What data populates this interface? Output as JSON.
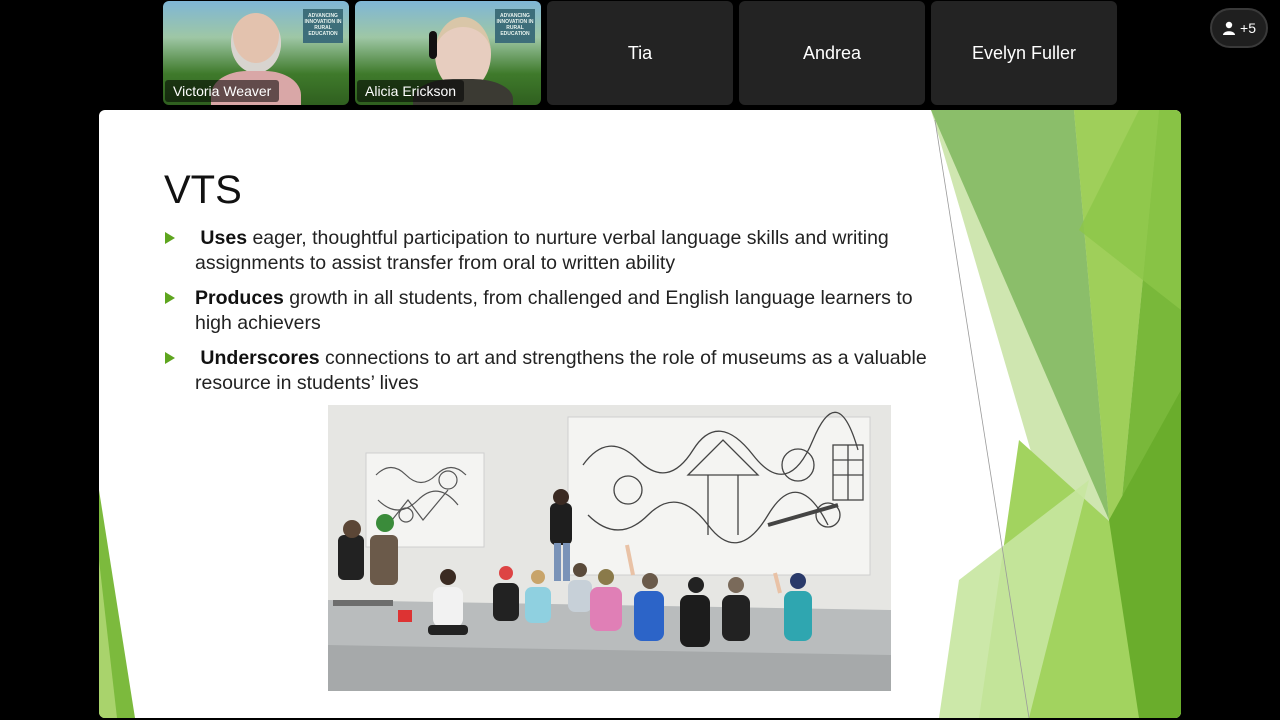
{
  "participants": [
    {
      "name": "Victoria Weaver",
      "video": true,
      "logo_text": "ADVANCING INNOVATION IN RURAL EDUCATION"
    },
    {
      "name": "Alicia Erickson",
      "video": true,
      "logo_text": "ADVANCING INNOVATION IN RURAL EDUCATION"
    },
    {
      "name": "Tia",
      "video": false
    },
    {
      "name": "Andrea",
      "video": false
    },
    {
      "name": "Evelyn Fuller",
      "video": false
    }
  ],
  "overflow": {
    "label": "+5",
    "icon": "person-icon"
  },
  "slide": {
    "title": "VTS",
    "bullets": [
      {
        "bold": "Uses",
        "text": " eager, thoughtful participation to nurture verbal language skills and writing assignments to assist transfer from oral to written ability"
      },
      {
        "bold": "Produces",
        "text": " growth in all students, from challenged and English language learners to high achievers"
      },
      {
        "bold": "Underscores",
        "text": " connections to art and strengthens the role of museums as a valuable resource in students’ lives"
      }
    ],
    "colors": {
      "accent": "#5ea51f",
      "green_light": "#a8d46f",
      "green_dark": "#4f8f1c"
    }
  }
}
